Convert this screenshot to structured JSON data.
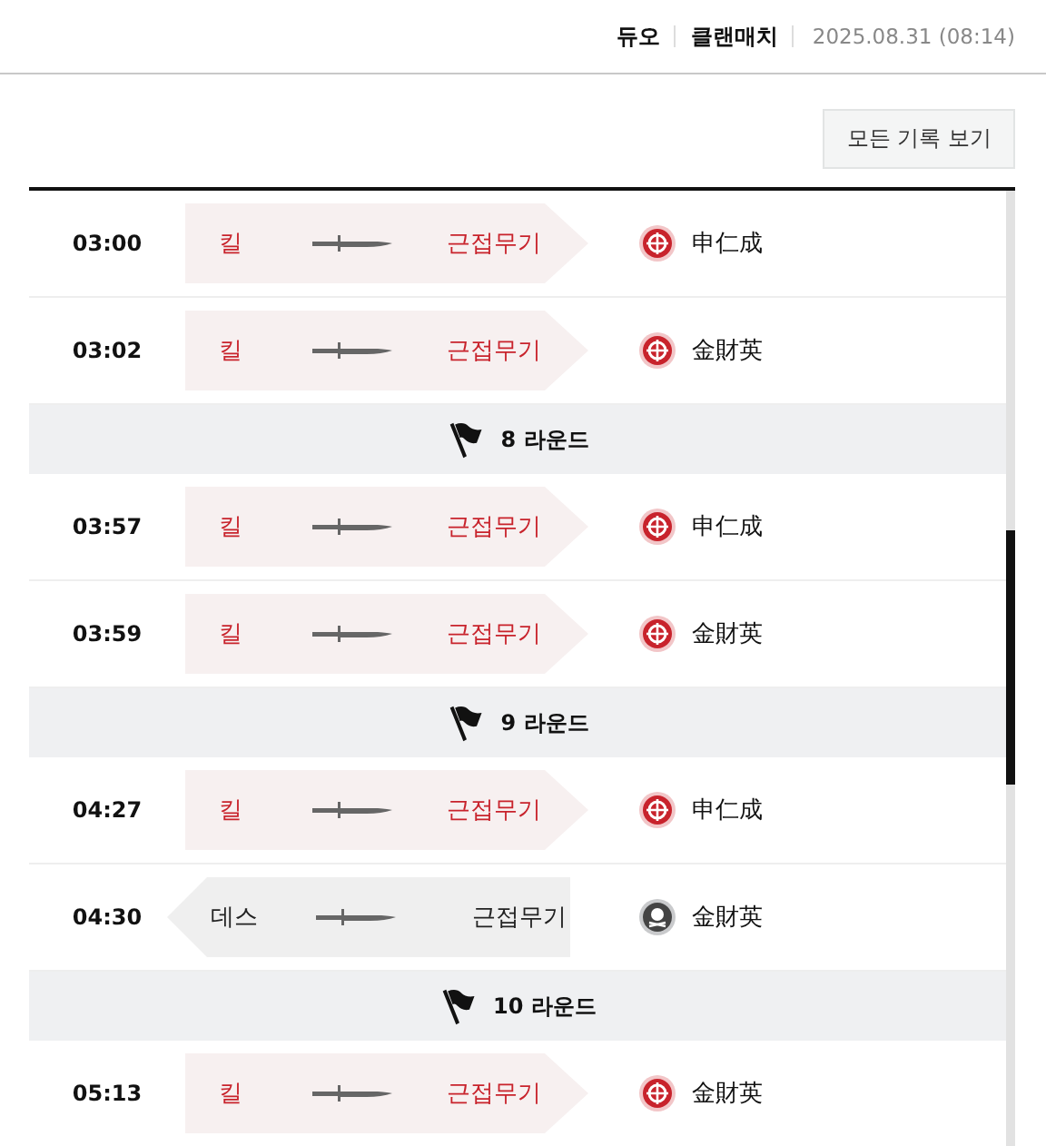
{
  "header": {
    "mode": "듀오",
    "match_type": "클랜매치",
    "datetime": "2025.08.31 (08:14)"
  },
  "view_all_button": "모든 기록 보기",
  "timeline": [
    {
      "kind": "kill",
      "time": "03:00",
      "action": "킬",
      "weapon": "근접무기",
      "player": "申仁成"
    },
    {
      "kind": "kill",
      "time": "03:02",
      "action": "킬",
      "weapon": "근접무기",
      "player": "金財英"
    },
    {
      "kind": "round",
      "label": "8 라운드"
    },
    {
      "kind": "kill",
      "time": "03:57",
      "action": "킬",
      "weapon": "근접무기",
      "player": "申仁成"
    },
    {
      "kind": "kill",
      "time": "03:59",
      "action": "킬",
      "weapon": "근접무기",
      "player": "金財英"
    },
    {
      "kind": "round",
      "label": "9 라운드"
    },
    {
      "kind": "kill",
      "time": "04:27",
      "action": "킬",
      "weapon": "근접무기",
      "player": "申仁成"
    },
    {
      "kind": "death",
      "time": "04:30",
      "action": "데스",
      "weapon": "근접무기",
      "player": "金財英"
    },
    {
      "kind": "round",
      "label": "10 라운드"
    },
    {
      "kind": "kill",
      "time": "05:13",
      "action": "킬",
      "weapon": "근접무기",
      "player": "金財英"
    }
  ]
}
